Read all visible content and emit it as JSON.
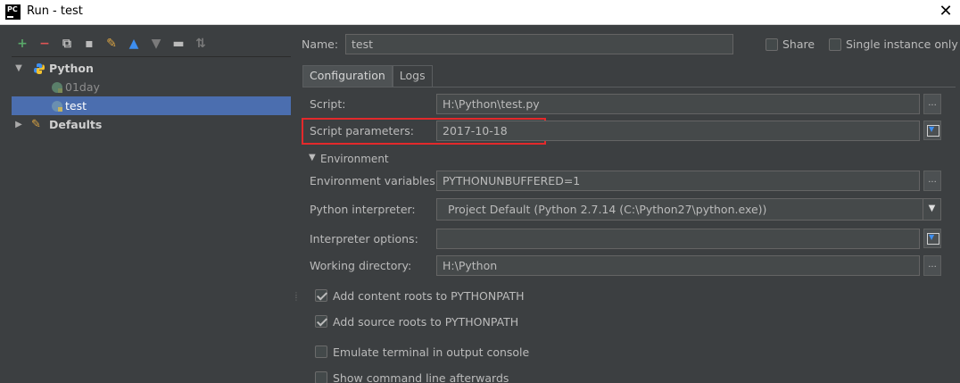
{
  "window": {
    "title": "Run - test"
  },
  "toolbar": [
    {
      "name": "add-icon",
      "glyph": "+",
      "color": "#59a869"
    },
    {
      "name": "remove-icon",
      "glyph": "−",
      "color": "#e05555"
    },
    {
      "name": "copy-icon",
      "glyph": "⧉",
      "color": "#bbbbbb"
    },
    {
      "name": "save-icon",
      "glyph": "▪",
      "color": "#bbbbbb"
    },
    {
      "name": "wrench-icon",
      "glyph": "✎",
      "color": "#d9a343"
    },
    {
      "name": "move-up-icon",
      "glyph": "▲",
      "color": "#3d8ef0"
    },
    {
      "name": "move-down-icon",
      "glyph": "▼",
      "color": "#7a7a7a"
    },
    {
      "name": "folder-icon",
      "glyph": "▬",
      "color": "#bbbbbb"
    },
    {
      "name": "sort-icon",
      "glyph": "⇅",
      "color": "#7a7a7a"
    }
  ],
  "tree": {
    "python": "Python",
    "items": [
      "01day",
      "test"
    ],
    "defaults": "Defaults"
  },
  "form": {
    "name_label": "Name:",
    "name_value": "test",
    "share_label": "Share",
    "single_instance_label": "Single instance only",
    "tabs": [
      "Configuration",
      "Logs"
    ],
    "script_label": "Script:",
    "script_value": "H:\\Python\\test.py",
    "script_params_label": "Script parameters:",
    "script_params_value": "2017-10-18",
    "environment_label": "Environment",
    "env_vars_label": "Environment variables:",
    "env_vars_value": "PYTHONUNBUFFERED=1",
    "interpreter_label": "Python interpreter:",
    "interpreter_value": "Project Default (Python 2.7.14 (C:\\Python27\\python.exe))",
    "interp_options_label": "Interpreter options:",
    "interp_options_value": "",
    "working_dir_label": "Working directory:",
    "working_dir_value": "H:\\Python",
    "add_content_roots": "Add content roots to PYTHONPATH",
    "add_source_roots": "Add source roots to PYTHONPATH",
    "emulate_terminal": "Emulate terminal in output console",
    "show_cmdline": "Show command line afterwards",
    "ellipsis": "..."
  },
  "colors": {
    "selection": "#4b6eaf",
    "highlight": "#e3292b",
    "background": "#3c3f41"
  }
}
